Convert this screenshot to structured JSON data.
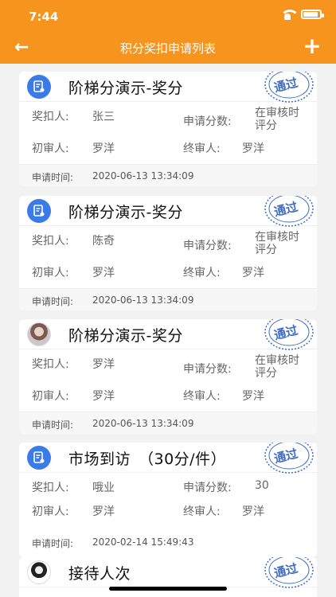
{
  "status_bar": {
    "time": "7:44"
  },
  "header": {
    "title": "积分奖扣申请列表",
    "back_icon": "arrow-left-icon",
    "add_icon": "plus-icon",
    "back_glyph": "←",
    "add_glyph": "+"
  },
  "labels": {
    "awardee": "奖扣人:",
    "points": "申请分数:",
    "first_reviewer": "初审人:",
    "final_reviewer": "终审人:",
    "apply_time": "申请时间:"
  },
  "cards": [
    {
      "title": "阶梯分演示-奖分",
      "avatar": "doc-icon",
      "stamp": "通过",
      "awardee": "张三",
      "points": "在审核时评分",
      "first_reviewer": "罗洋",
      "final_reviewer": "罗洋",
      "time": "2020-06-13 13:34:09"
    },
    {
      "title": "阶梯分演示-奖分",
      "avatar": "doc-icon",
      "stamp": "通过",
      "awardee": "陈奇",
      "points": "在审核时评分",
      "first_reviewer": "罗洋",
      "final_reviewer": "罗洋",
      "time": "2020-06-13 13:34:09"
    },
    {
      "title": "阶梯分演示-奖分",
      "avatar": "user-photo",
      "stamp": "通过",
      "awardee": "罗洋",
      "points": "在审核时评分",
      "first_reviewer": "罗洋",
      "final_reviewer": "罗洋",
      "time": "2020-06-13 13:34:09"
    },
    {
      "title": "市场到访　（30分/件）",
      "avatar": "doc-icon",
      "stamp": "通过",
      "awardee": "哦业",
      "points": "30",
      "first_reviewer": "罗洋",
      "final_reviewer": "罗洋",
      "time": "2020-02-14 15:49:43"
    },
    {
      "title": "接待人次",
      "avatar": "user-photo",
      "stamp": "通过"
    }
  ],
  "colors": {
    "accent": "#f7941d",
    "stamp": "#3f6ec4",
    "doc_icon_bg": "#3b7be8"
  }
}
